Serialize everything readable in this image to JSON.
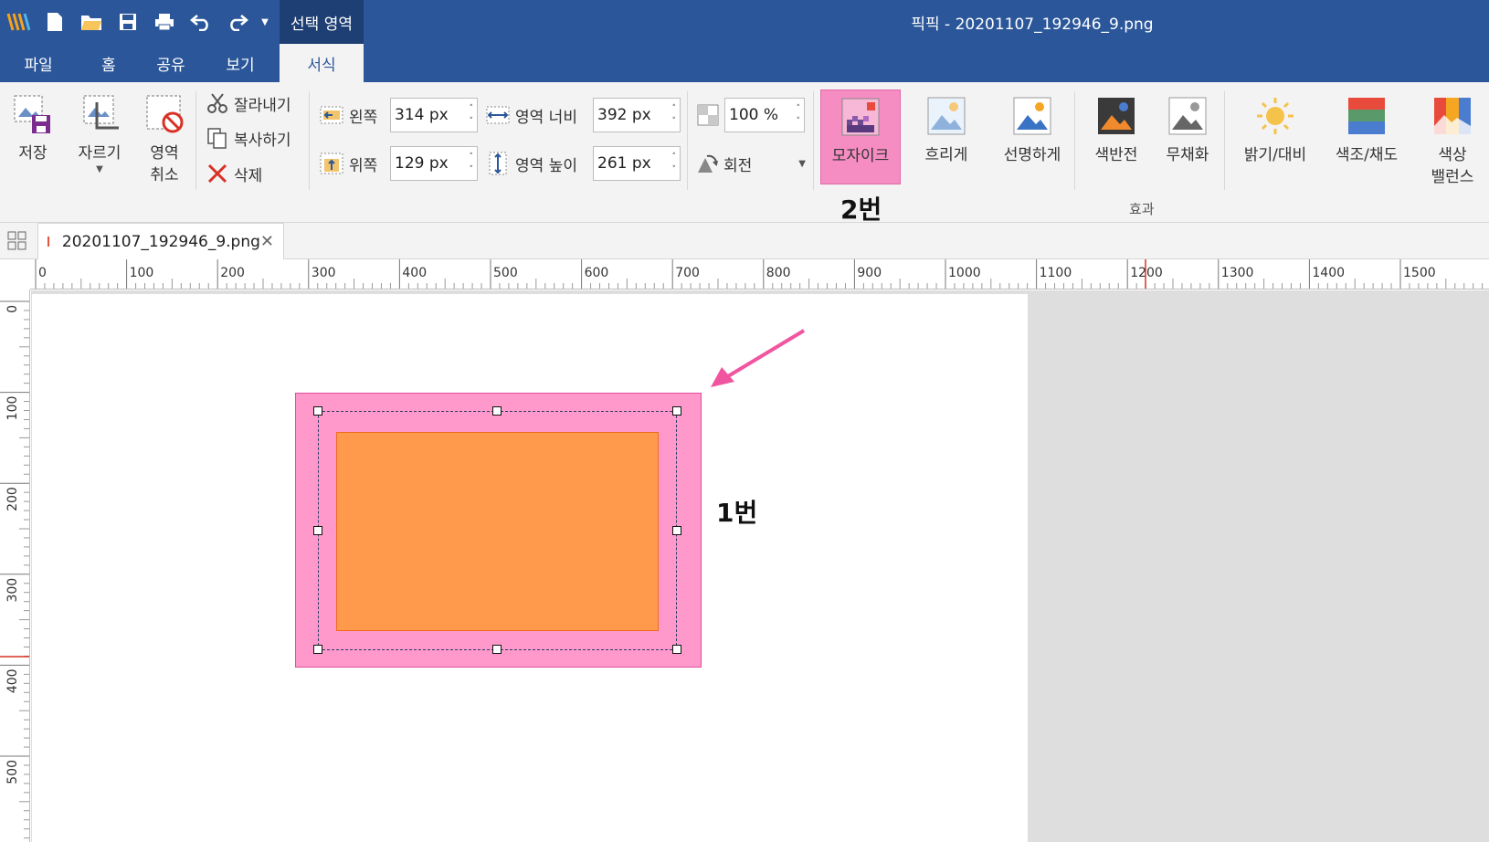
{
  "window": {
    "title": "픽픽 - 20201107_192946_9.png",
    "context_tab_header": "선택 영역"
  },
  "quick_access": {
    "items": [
      "app-logo-icon",
      "new-file-icon",
      "open-folder-icon",
      "save-icon",
      "print-icon",
      "undo-icon",
      "redo-icon",
      "dropdown-icon"
    ]
  },
  "menu_tabs": [
    "파일",
    "홈",
    "공유",
    "보기",
    "서식"
  ],
  "menu_active": "서식",
  "ribbon": {
    "save": "저장",
    "crop": "자르기",
    "cancel_sel_line1": "영역",
    "cancel_sel_line2": "취소",
    "cut": "잘라내기",
    "copy": "복사하기",
    "delete": "삭제",
    "left_label": "왼쪽",
    "left_value": "314 px",
    "top_label": "위쪽",
    "top_value": "129 px",
    "width_label": "영역 너비",
    "width_value": "392 px",
    "height_label": "영역 높이",
    "height_value": "261 px",
    "zoom_value": "100 %",
    "rotate": "회전",
    "mosaic": "모자이크",
    "blur": "흐리게",
    "sharpen": "선명하게",
    "invert": "색반전",
    "grayscale": "무채화",
    "brightness": "밝기/대비",
    "hue": "색조/채도",
    "balance_line1": "색상",
    "balance_line2": "밸런스",
    "effects_group": "효과",
    "annotation_2": "2번"
  },
  "doc_tab": {
    "name": "20201107_192946_9.png",
    "close": "✕"
  },
  "ruler": {
    "h_labels": [
      "0",
      "100",
      "200",
      "300",
      "400",
      "500",
      "600",
      "700",
      "800",
      "900",
      "1000",
      "1100",
      "1200",
      "1300",
      "1400",
      "1500"
    ],
    "v_labels": [
      "0",
      "100",
      "200",
      "300",
      "400",
      "500"
    ]
  },
  "canvas": {
    "annotation_1": "1번",
    "selection_color": "#ff99cc",
    "image_color": "#ff9a4d",
    "arrow_color": "#f2559f"
  }
}
